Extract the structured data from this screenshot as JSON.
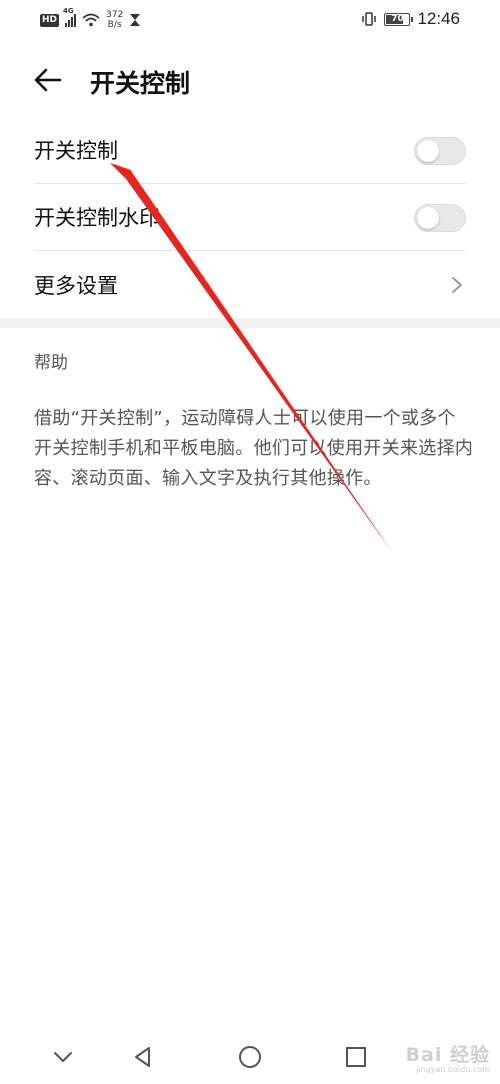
{
  "status_bar": {
    "hd": "HD",
    "network": "4G",
    "speed_value": "372",
    "speed_unit": "B/s",
    "battery": "70",
    "time": "12:46"
  },
  "header": {
    "title": "开关控制"
  },
  "settings": [
    {
      "label": "开关控制",
      "type": "toggle",
      "on": false
    },
    {
      "label": "开关控制水印",
      "type": "toggle",
      "on": false
    },
    {
      "label": "更多设置",
      "type": "link"
    }
  ],
  "help": {
    "title": "帮助",
    "text": "借助“开关控制”，运动障碍人士可以使用一个或多个开关控制手机和平板电脑。他们可以使用开关来选择内容、滚动页面、输入文字及执行其他操作。"
  },
  "watermark": {
    "main": "Bai 经验",
    "sub": "jingyan.baidu.com"
  },
  "colors": {
    "annotation_arrow": "#e8241c",
    "toggle_off": "#e8e8e8",
    "divider": "#e6e6e6",
    "section_band": "#f1f1f1"
  }
}
